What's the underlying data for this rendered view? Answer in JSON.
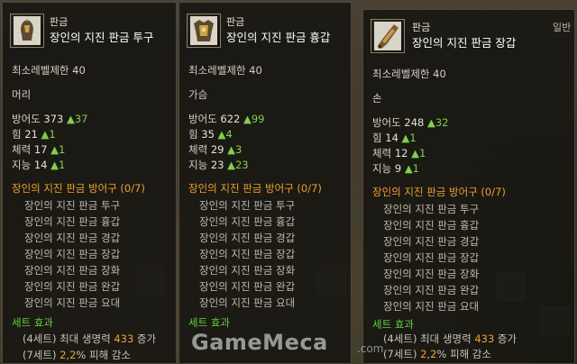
{
  "tooltips": [
    {
      "grade": "판금",
      "name": "장인의 지진 판금 투구",
      "min_level": "최소레벨제한 40",
      "slot": "머리",
      "stats": [
        {
          "label": "방어도",
          "value": "373",
          "bonus": "▲37"
        },
        {
          "label": "힘",
          "value": "21",
          "bonus": "▲1"
        },
        {
          "label": "체력",
          "value": "17",
          "bonus": "▲1"
        },
        {
          "label": "지능",
          "value": "14",
          "bonus": "▲1"
        }
      ],
      "set_name": "장인의 지진 판금 방어구 (0/7)",
      "set_pieces": [
        "장인의 지진 판금 투구",
        "장인의 지진 판금 흉갑",
        "장인의 지진 판금 경갑",
        "장인의 지진 판금 장갑",
        "장인의 지진 판금 장화",
        "장인의 지진 판금 완갑",
        "장인의 지진 판금 요대"
      ],
      "set_effect_title": "세트 효과",
      "set_effect_1_prefix": "(4세트) 최대 생명력 ",
      "set_effect_1_num": "433",
      "set_effect_1_suffix": " 증가",
      "set_effect_2_prefix": "(7세트) ",
      "set_effect_2_num": "2,2",
      "set_effect_2_suffix": "% 피해 감소"
    },
    {
      "grade": "판금",
      "name": "장인의 지진 판금 흉갑",
      "min_level": "최소레벨제한 40",
      "slot": "가슴",
      "stats": [
        {
          "label": "방어도",
          "value": "622",
          "bonus": "▲99"
        },
        {
          "label": "힘",
          "value": "35",
          "bonus": "▲4"
        },
        {
          "label": "체력",
          "value": "29",
          "bonus": "▲3"
        },
        {
          "label": "지능",
          "value": "23",
          "bonus": "▲23"
        }
      ],
      "set_name": "장인의 지진 판금 방어구 (0/7)",
      "set_pieces": [
        "장인의 지진 판금 투구",
        "장인의 지진 판금 흉갑",
        "장인의 지진 판금 경갑",
        "장인의 지진 판금 장갑",
        "장인의 지진 판금 장화",
        "장인의 지진 판금 완갑",
        "장인의 지진 판금 요대"
      ],
      "set_effect_title": "세트 효과",
      "set_effect_1_prefix": "",
      "set_effect_1_num": "",
      "set_effect_1_suffix": "",
      "set_effect_2_prefix": "",
      "set_effect_2_num": "",
      "set_effect_2_suffix": ""
    },
    {
      "grade": "판금",
      "name": "장인의 지진 판금 장갑",
      "topright": "일반",
      "min_level": "최소레벨제한 40",
      "slot": "손",
      "stats": [
        {
          "label": "방어도",
          "value": "248",
          "bonus": "▲32"
        },
        {
          "label": "힘",
          "value": "14",
          "bonus": "▲1"
        },
        {
          "label": "체력",
          "value": "12",
          "bonus": "▲1"
        },
        {
          "label": "지능",
          "value": "9",
          "bonus": "▲1"
        }
      ],
      "set_name": "장인의 지진 판금 방어구 (0/7)",
      "set_pieces": [
        "장인의 지진 판금 투구",
        "장인의 지진 판금 흉갑",
        "장인의 지진 판금 경갑",
        "장인의 지진 판금 장갑",
        "장인의 지진 판금 장화",
        "장인의 지진 판금 완갑",
        "장인의 지진 판금 요대"
      ],
      "set_effect_title": "세트 효과",
      "set_effect_1_prefix": "(4세트) 최대 생명력 ",
      "set_effect_1_num": "433",
      "set_effect_1_suffix": " 증가",
      "set_effect_2_prefix": "(7세트) ",
      "set_effect_2_num": "2,2",
      "set_effect_2_suffix": "% 피해 감소"
    }
  ],
  "watermark": "GameMeca",
  "watermark_suffix": ".com",
  "colors": {
    "bonus": "#7fd04a",
    "set_name": "#f0a030",
    "effect": "#5fd33f"
  },
  "icons": [
    "helmet-icon",
    "chest-armor-icon",
    "gauntlet-icon"
  ]
}
